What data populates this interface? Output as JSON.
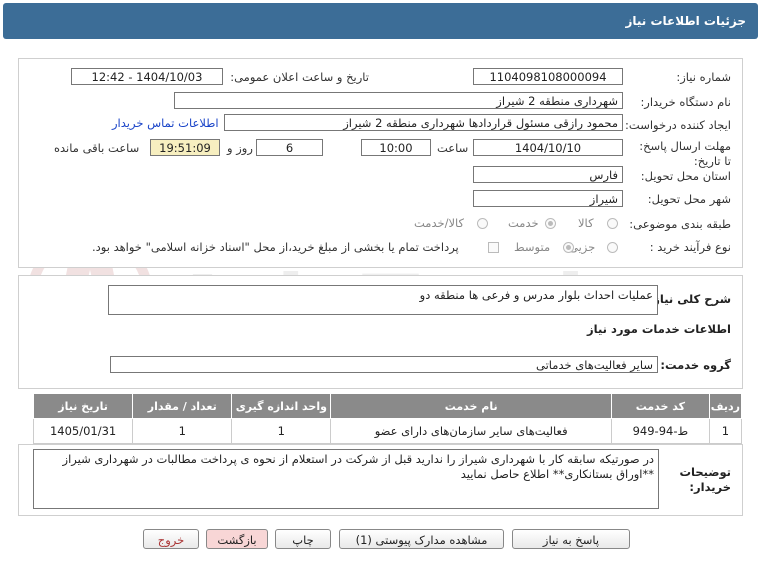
{
  "header": {
    "title": "جزئیات اطلاعات نیاز"
  },
  "form": {
    "need_number_label": "شماره نیاز:",
    "need_number": "1104098108000094",
    "announce_label": "تاریخ و ساعت اعلان عمومی:",
    "announce_value": "1404/10/03 - 12:42",
    "buyer_org_label": "نام دستگاه خریدار:",
    "buyer_org": "شهرداری منطقه 2 شیراز",
    "creator_label": "ایجاد کننده درخواست:",
    "creator": "محمود رازقی مسئول قراردادها شهرداری منطقه 2 شیراز",
    "contact_link": "اطلاعات تماس خریدار",
    "deadline_label": "مهلت ارسال پاسخ: تا تاریخ:",
    "deadline_date": "1404/10/10",
    "time_label": "ساعت",
    "deadline_time": "10:00",
    "days": "6",
    "days_label": "روز و",
    "remaining_time": "19:51:09",
    "remaining_label": "ساعت باقی مانده",
    "province_label": "استان محل تحویل:",
    "province": "فارس",
    "city_label": "شهر محل تحویل:",
    "city": "شیراز",
    "category_label": "طبقه بندی موضوعی:",
    "category_options": [
      "کالا",
      "خدمت",
      "کالا/خدمت"
    ],
    "process_label": "نوع فرآیند خرید :",
    "process_options": [
      "جزیی",
      "متوسط"
    ],
    "payment_note": "پرداخت تمام یا بخشی از مبلغ خرید،از محل \"اسناد خزانه اسلامی\" خواهد بود."
  },
  "summary": {
    "label": "شرح کلی نیاز:",
    "value": "عملیات احداث بلوار مدرس و فرعی ها منطقه دو"
  },
  "services": {
    "section_title": "اطلاعات خدمات مورد نیاز",
    "group_label": "گروه خدمت:",
    "group_value": "سایر فعالیت‌های خدماتی",
    "columns": [
      "ردیف",
      "کد خدمت",
      "نام خدمت",
      "واحد اندازه گیری",
      "تعداد / مقدار",
      "تاریخ نیاز"
    ],
    "rows": [
      {
        "row": "1",
        "code": "ط-94-949",
        "name": "فعالیت‌های سایر سازمان‌های دارای عضو",
        "unit": "1",
        "qty": "1",
        "date": "1405/01/31"
      }
    ]
  },
  "notes": {
    "label": "توضیحات خریدار:",
    "value": "در صورتیکه سابقه کار با شهرداری شیراز را ندارید قبل از شرکت در استعلام از نحوه ی پرداخت مطالبات در شهرداری شیراز **اوراق بستانکاری** اطلاع حاصل نمایید"
  },
  "buttons": {
    "reply": "پاسخ به نیاز",
    "docs": "مشاهده مدارک پیوستی (1)",
    "print": "چاپ",
    "back": "بازگشت",
    "exit": "خروج"
  },
  "watermark": {
    "text": "AriaTender.neT"
  }
}
